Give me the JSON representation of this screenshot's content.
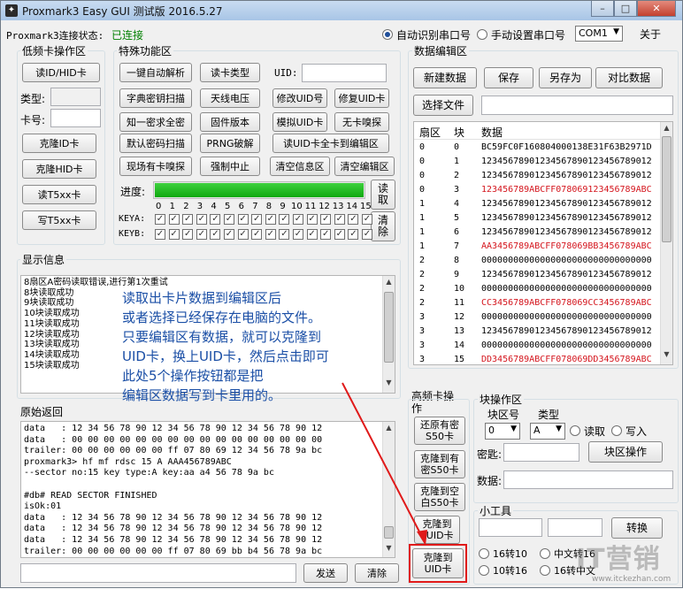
{
  "window": {
    "title": "Proxmark3 Easy GUI 测试版 2016.5.27",
    "app_icon": "proxmark-icon",
    "minimize": "–",
    "maximize": "□",
    "close": "✕"
  },
  "status": {
    "label": "Proxmark3连接状态:",
    "value": "已连接",
    "value_color": "#008000"
  },
  "port": {
    "auto_label": "自动识别串口号",
    "manual_label": "手动设置串口号",
    "selected": "COM1",
    "about": "关于"
  },
  "lf": {
    "title": "低频卡操作区",
    "read_btn": "读ID/HID卡",
    "type_label": "类型:",
    "type_value": "",
    "id_label": "卡号:",
    "id_value": "",
    "clone_id": "克隆ID卡",
    "clone_hid": "克隆HID卡",
    "read_t5": "读T5xx卡",
    "write_t5": "写T5xx卡"
  },
  "special": {
    "title": "特殊功能区",
    "row1": [
      "一键自动解析",
      "读卡类型"
    ],
    "uid_label": "UID:",
    "uid_value": "",
    "row2": [
      "字典密钥扫描",
      "天线电压",
      "修改UID号",
      "修复UID卡"
    ],
    "row3": [
      "知一密求全密",
      "固件版本",
      "模拟UID卡",
      "无卡嗅探"
    ],
    "row4": [
      "默认密码扫描",
      "PRNG破解",
      "读UID卡全卡到编辑区"
    ],
    "row5": [
      "现场有卡嗅探",
      "强制中止",
      "清空信息区",
      "清空编辑区"
    ],
    "progress_label": "进度:",
    "progress": 1.0,
    "read_btn": "读\n取",
    "clear_btn": "清\n除",
    "sectors": [
      "0",
      "1",
      "2",
      "3",
      "4",
      "5",
      "6",
      "7",
      "8",
      "9",
      "10",
      "11",
      "12",
      "13",
      "14",
      "15"
    ],
    "keya_label": "KEYA:",
    "keyb_label": "KEYB:"
  },
  "info": {
    "title": "显示信息",
    "lines": [
      "8扇区A密码读取错误,进行第1次重试",
      "8块读取成功",
      "9块读取成功",
      "10块读取成功",
      "11块读取成功",
      "12块读取成功",
      "13块读取成功",
      "14块读取成功",
      "15块读取成功"
    ],
    "annotation": [
      "读取出卡片数据到编辑区后",
      "或者选择已经保存在电脑的文件。",
      "只要编辑区有数据，就可以克隆到",
      "UID卡，换上UID卡，然后点击即可",
      "此处5个操作按钮都是把",
      "编辑区数据写到卡里用的。"
    ]
  },
  "raw": {
    "title": "原始返回",
    "lines": [
      "data   : 12 34 56 78 90 12 34 56 78 90 12 34 56 78 90 12",
      "data   : 00 00 00 00 00 00 00 00 00 00 00 00 00 00 00 00",
      "trailer: 00 00 00 00 00 00 ff 07 80 69 12 34 56 78 9a bc",
      "proxmark3> hf mf rdsc 15 A AAA456789ABC",
      "--sector no:15 key type:A key:aa a4 56 78 9a bc",
      "",
      "#db# READ SECTOR FINISHED",
      "isOk:01",
      "data   : 12 34 56 78 90 12 34 56 78 90 12 34 56 78 90 12",
      "data   : 12 34 56 78 90 12 34 56 78 90 12 34 56 78 90 12",
      "data   : 12 34 56 78 90 12 34 56 78 90 12 34 56 78 90 12",
      "trailer: 00 00 00 00 00 00 ff 07 80 69 bb b4 56 78 9a bc"
    ],
    "send_btn": "发送",
    "clear_btn": "清除",
    "cmd_value": ""
  },
  "editor": {
    "title": "数据编辑区",
    "new_btn": "新建数据",
    "save_btn": "保存",
    "saveas_btn": "另存为",
    "compare_btn": "对比数据",
    "open_btn": "选择文件",
    "file_value": "",
    "columns": [
      "扇区",
      "块",
      "数据"
    ],
    "rows": [
      {
        "s": "0",
        "b": "0",
        "d": "BC59FC0F160804000138E31F63B2971D",
        "red": false
      },
      {
        "s": "0",
        "b": "1",
        "d": "12345678901234567890123456789012",
        "red": false
      },
      {
        "s": "0",
        "b": "2",
        "d": "12345678901234567890123456789012",
        "red": false
      },
      {
        "s": "0",
        "b": "3",
        "d": "123456789ABCFF078069123456789ABC",
        "red": true
      },
      {
        "s": "1",
        "b": "4",
        "d": "12345678901234567890123456789012",
        "red": false
      },
      {
        "s": "1",
        "b": "5",
        "d": "12345678901234567890123456789012",
        "red": false
      },
      {
        "s": "1",
        "b": "6",
        "d": "12345678901234567890123456789012",
        "red": false
      },
      {
        "s": "1",
        "b": "7",
        "d": "AA3456789ABCFF078069BB3456789ABC",
        "red": true
      },
      {
        "s": "2",
        "b": "8",
        "d": "00000000000000000000000000000000",
        "red": false
      },
      {
        "s": "2",
        "b": "9",
        "d": "12345678901234567890123456789012",
        "red": false
      },
      {
        "s": "2",
        "b": "10",
        "d": "00000000000000000000000000000000",
        "red": false
      },
      {
        "s": "2",
        "b": "11",
        "d": "CC3456789ABCFF078069CC3456789ABC",
        "red": true
      },
      {
        "s": "3",
        "b": "12",
        "d": "00000000000000000000000000000000",
        "red": false
      },
      {
        "s": "3",
        "b": "13",
        "d": "12345678901234567890123456789012",
        "red": false
      },
      {
        "s": "3",
        "b": "14",
        "d": "00000000000000000000000000000000",
        "red": false
      },
      {
        "s": "3",
        "b": "15",
        "d": "DD3456789ABCFF078069DD3456789ABC",
        "red": true
      }
    ]
  },
  "hf": {
    "title": "高频卡操\n作",
    "restore_s50": "还原有密\nS50卡",
    "clone_s50": "克隆到有\n密S50卡",
    "clone_blank": "克隆到空\n白S50卡",
    "clone_fuid": "克隆到\nFUID卡",
    "clone_uid": "克隆到\nUID卡"
  },
  "block": {
    "title": "块操作区",
    "block_label": "块区号",
    "type_label": "类型",
    "block_value": "0",
    "type_value": "A",
    "read_label": "读取",
    "write_label": "写入",
    "key_label": "密匙:",
    "key_value": "",
    "btn": "块区操作",
    "data_label": "数据:",
    "data_value": ""
  },
  "tools": {
    "title": "小工具",
    "in1": "",
    "in2": "",
    "convert": "转换",
    "r1": "16转10",
    "r2": "中文转16",
    "r3": "10转16",
    "r4": "16转中文"
  },
  "watermark": {
    "text": "IT营销",
    "url": "www.itckezhan.com"
  }
}
